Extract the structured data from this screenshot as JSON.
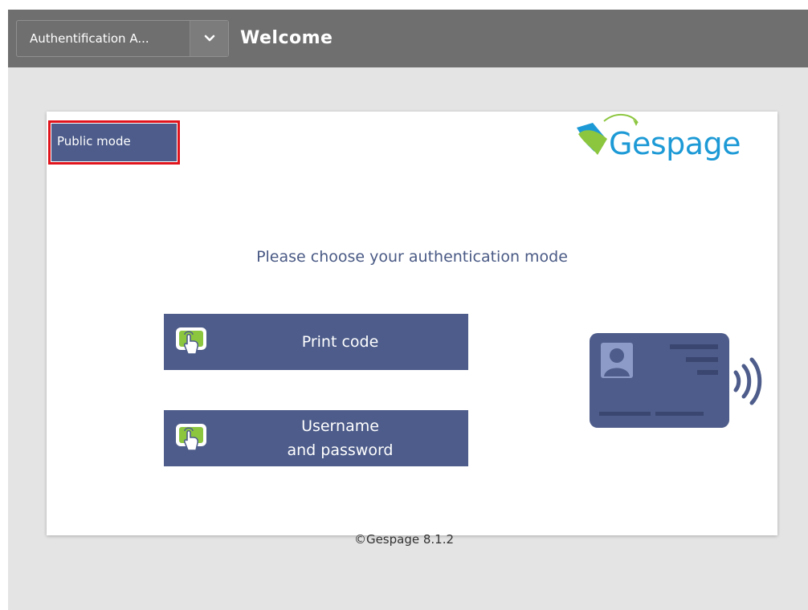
{
  "topbar": {
    "mode_select_value": "Authentification A...",
    "title": "Welcome"
  },
  "card": {
    "public_mode_label": "Public mode",
    "logo_text": "Gespage",
    "prompt": "Please choose your authentication mode",
    "buttons": [
      {
        "label": "Print code",
        "icon": "touch-hand-icon"
      },
      {
        "label": "Username\nand password",
        "icon": "touch-hand-icon"
      }
    ],
    "illustration_icon": "contactless-badge-icon"
  },
  "footer": {
    "copyright": "©Gespage 8.1.2"
  },
  "colors": {
    "topbar": "#6f6f6f",
    "background": "#e4e4e4",
    "button": "#4d5c8a",
    "highlight": "#e0141c",
    "logo_blue": "#1d9ad6",
    "logo_green": "#8cc63f"
  }
}
